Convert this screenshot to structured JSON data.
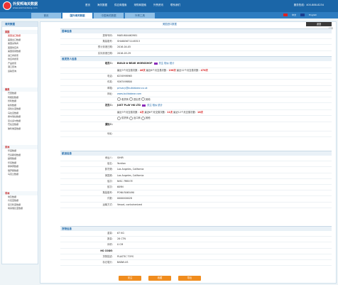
{
  "header": {
    "logo_cn": "外贸邦海关数据",
    "logo_en": "www.waimaobang.com",
    "nav": [
      "首页",
      "海关数据",
      "供应商搜索",
      "采购商搜索",
      "外贸资讯",
      "联系我们"
    ],
    "hotline": "服务热线：400-888-8234"
  },
  "tabs": [
    "首页",
    "国外海关数据",
    "中国海关数据",
    "外贸工具"
  ],
  "active_tab": 1,
  "lang": {
    "cn": "中文",
    "en": "English"
  },
  "sidebar": {
    "title": "海关数据",
    "sections": [
      {
        "name": "美国",
        "items": [
          "美国进口数据",
          "美国出口数据",
          "美国采购商",
          "美国供应商",
          "美国贸易数据",
          "进口商搜索",
          "供应商搜索",
          "产品搜索",
          "港口查询",
          "运输查询"
        ]
      },
      {
        "name": "南美",
        "items": [
          "巴西数据",
          "阿根廷数据",
          "智利数据",
          "秘鲁数据",
          "哥伦比亚数据",
          "乌拉圭数据",
          "委内瑞拉数据",
          "厄瓜多尔数据",
          "巴拉圭数据",
          "玻利维亚数据"
        ]
      },
      {
        "name": "亚洲",
        "items": [
          "印度数据",
          "巴基斯坦数据",
          "越南数据",
          "印尼数据",
          "菲律宾数据",
          "俄罗斯数据",
          "乌克兰数据"
        ]
      },
      {
        "name": "非洲",
        "items": [
          "埃及数据",
          "肯尼亚数据",
          "尼日利亚数据",
          "埃塞俄比亚数据"
        ]
      }
    ]
  },
  "crumb": "美国进口数据",
  "back": "返回",
  "print": "打印",
  "basic": {
    "title": "提单信息",
    "rows": [
      [
        "提单号码：",
        "MAEU604462981"
      ],
      [
        "集装箱号：",
        "SHA805671148313"
      ],
      [
        "预计到港日期：",
        "2016-04-05"
      ],
      [
        "实际到港日期：",
        "2016-03-29"
      ]
    ]
  },
  "parties": {
    "title": "收发货人信息",
    "buyer_label": "收货人：",
    "buyer": "BUILD-A-BEAR WORKSHOP",
    "buyer_links": [
      "关注",
      "相似",
      "统计"
    ],
    "buyer_stats": [
      "最近3个月交易次数：",
      "46次",
      "最近6个月交易次数：",
      "196次",
      "最近12个月交易次数：",
      "476次"
    ],
    "phone_label": "电话：",
    "phone": "6234998965",
    "fax_label": "传真：",
    "fax": "9267498800",
    "email_label": "邮箱：",
    "email": "privacy@buildabear.co.uk",
    "web_label": "网址：",
    "web": "www.buildabear.com",
    "radio_opts": [
      "收货商",
      "进出境",
      "其他"
    ],
    "shipper_label": "发货人：",
    "shipper": "JUST PLAY HK LTD",
    "shipper_links": [
      "关注",
      "相似",
      "统计"
    ],
    "shipper_stats": [
      "最近3个月交易次数：",
      "4次",
      "最近6个月交易次数：",
      "11次",
      "最近12个月交易次数：",
      "18次"
    ],
    "radio_opts2": [
      "供货商",
      "出口商",
      "其他"
    ],
    "notify_label": "通知人：",
    "notify": "",
    "addr_label": "地址：",
    "addr": ""
  },
  "shipping": {
    "title": "航运信息",
    "rows": [
      [
        "承运人：",
        "SIHIR"
      ],
      [
        "船名：",
        "Yantian"
      ],
      [
        "卸货港：",
        "Los Angeles, California"
      ],
      [
        "美国港：",
        "Los Angeles, California"
      ],
      [
        "船次：",
        "NISC 7RB57E"
      ],
      [
        "航次：",
        "609N"
      ],
      [
        "集装箱号：",
        "PONU3065490"
      ],
      [
        "件数：",
        "0000000028"
      ],
      [
        "运输方式：",
        "Vessel, containerized"
      ]
    ]
  },
  "goods": {
    "title": "货物信息",
    "rows": [
      [
        "重量：",
        "67 KG"
      ],
      [
        "数量：",
        "28 CTN"
      ],
      [
        "体积：",
        "0 CM"
      ],
      [
        "HS CODE：",
        ""
      ],
      [
        "货物描述：",
        "PLASTIC TOYS"
      ],
      [
        "标记唛头：",
        "BABW-US"
      ]
    ]
  },
  "buttons": [
    "关注",
    "收藏",
    "导出"
  ]
}
